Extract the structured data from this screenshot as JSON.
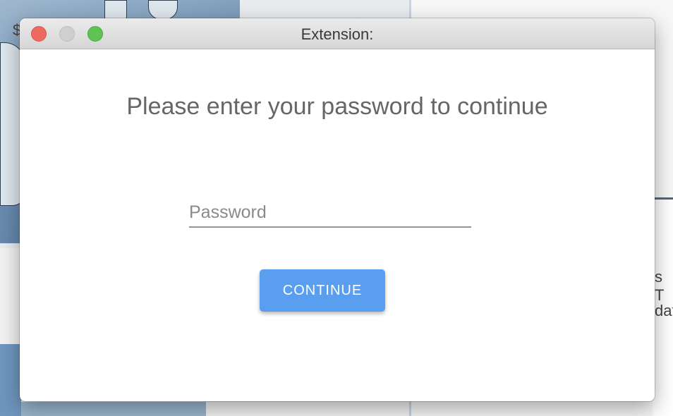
{
  "background": {
    "left_symbol": "$",
    "right_text_line1": "s T",
    "right_text_line2": "dat"
  },
  "window": {
    "title": "Extension:",
    "controls": {
      "close": "close-button",
      "minimize": "minimize-button",
      "zoom": "zoom-button"
    }
  },
  "dialog": {
    "prompt": "Please enter your password to continue",
    "password": {
      "value": "",
      "placeholder": "Password"
    },
    "continue_label": "CONTINUE"
  },
  "colors": {
    "accent": "#5a9ef0",
    "close": "#ee6a5e",
    "zoom": "#5fc454",
    "minimize": "#cfcfcf"
  }
}
